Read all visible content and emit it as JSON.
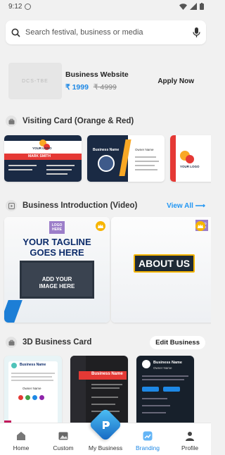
{
  "status": {
    "time": "9:12"
  },
  "search": {
    "placeholder": "Search festival, business or media"
  },
  "promo": {
    "title": "Business Website",
    "price": "₹ 1999",
    "old_price": "₹ 4999",
    "cta": "Apply Now",
    "thumb_text": "DCS-TBE"
  },
  "sections": {
    "visiting": {
      "title": "Visiting Card (Orange & Red)"
    },
    "video": {
      "title": "Business Introduction (Video)",
      "link": "View All ⟶"
    },
    "business3d": {
      "title": "3D Business Card",
      "action": "Edit Business"
    }
  },
  "video_cards": {
    "tagline_1": "YOUR TAGLINE",
    "tagline_2": "GOES HERE",
    "logo_1": "LOGO",
    "logo_2": "HERE",
    "image_1": "ADD YOUR",
    "image_2": "IMAGE HERE",
    "about": "ABOUT US"
  },
  "cards_text": {
    "your_logo": "YOUR LOGO",
    "name": "MARK SMITH",
    "owner": "Owner Name",
    "business_name": "Business Name"
  },
  "nav": [
    {
      "label": "Home"
    },
    {
      "label": "Custom"
    },
    {
      "label": "My Business"
    },
    {
      "label": "Branding"
    },
    {
      "label": "Profile"
    }
  ],
  "colors": {
    "accent": "#1e88e5",
    "price": "#1e88e5",
    "card_red": "#e53935",
    "card_navy": "#1a2a44",
    "card_orange": "#f9a825"
  }
}
